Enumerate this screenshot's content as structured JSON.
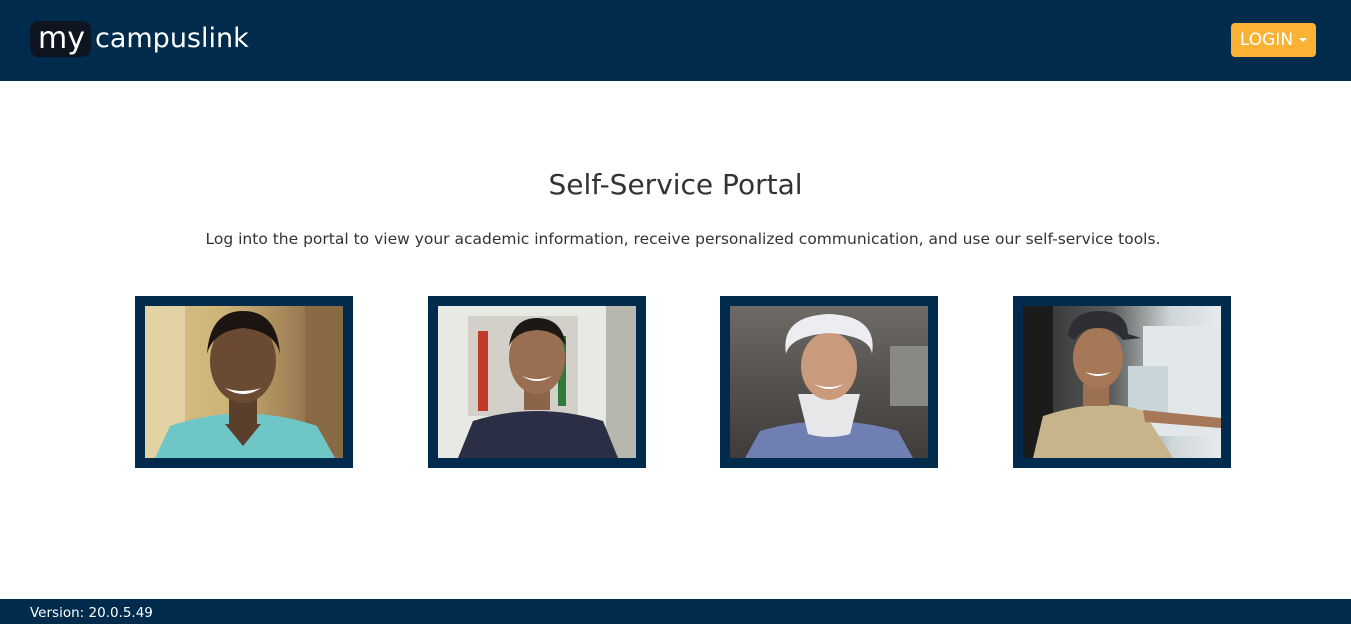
{
  "header": {
    "logo": {
      "my": "my",
      "rest": "campuslink"
    },
    "login_label": "LOGIN"
  },
  "main": {
    "title": "Self-Service Portal",
    "subtitle": "Log into the portal to view your academic information, receive personalized communication, and use our self-service tools."
  },
  "photos": [
    {
      "name": "nurse-in-scrubs"
    },
    {
      "name": "technician-with-van"
    },
    {
      "name": "surgical-tech-with-mask"
    },
    {
      "name": "truck-driver"
    }
  ],
  "footer": {
    "version": "Version: 20.0.5.49"
  },
  "colors": {
    "navy": "#002b4d",
    "accent": "#f9b233"
  }
}
